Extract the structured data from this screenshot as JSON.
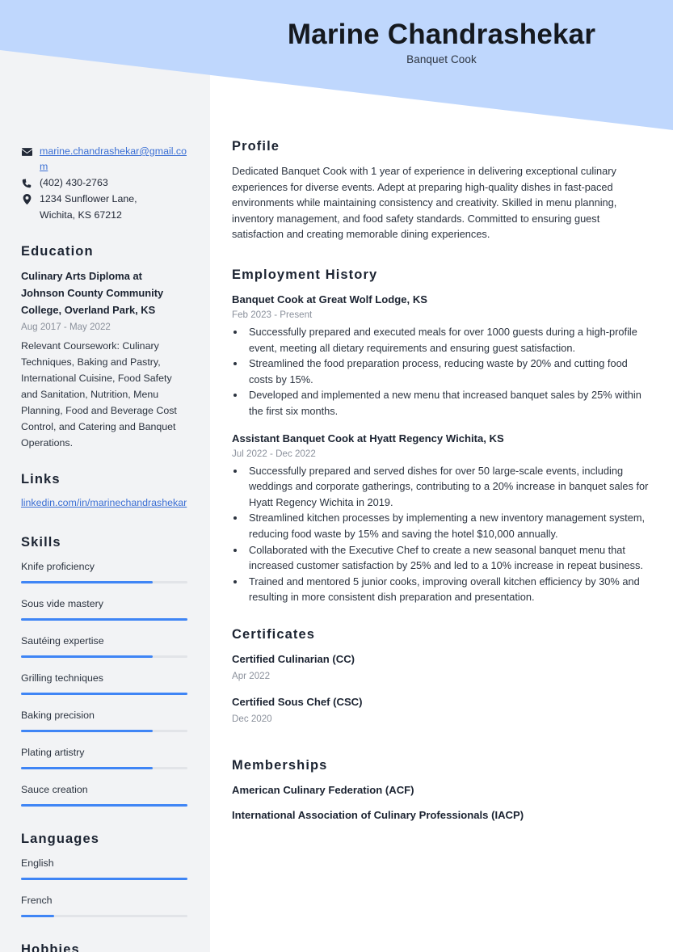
{
  "header": {
    "name": "Marine Chandrashekar",
    "job_title": "Banquet Cook",
    "band_color": "#bfd7fd"
  },
  "theme": {
    "accent": "#3f85f5",
    "link": "#3b6fd4",
    "sidebar_bg": "#f2f3f5",
    "text": "#232a38",
    "muted": "#8b919c"
  },
  "sidebar": {
    "contact": {
      "email": {
        "icon": "envelope-icon",
        "value": "marine.chandrashekar@gmail.com"
      },
      "phone": {
        "icon": "phone-icon",
        "value": "(402) 430-2763"
      },
      "address": {
        "icon": "map-pin-icon",
        "line1": "1234 Sunflower Lane,",
        "line2": "Wichita, KS 67212"
      }
    },
    "education": {
      "heading": "Education",
      "items": [
        {
          "title": "Culinary Arts Diploma at Johnson County Community College, Overland Park, KS",
          "date": "Aug 2017 - May 2022",
          "description": "Relevant Coursework: Culinary Techniques, Baking and Pastry, International Cuisine, Food Safety and Sanitation, Nutrition, Menu Planning, Food and Beverage Cost Control, and Catering and Banquet Operations."
        }
      ]
    },
    "links": {
      "heading": "Links",
      "items": [
        {
          "label": "linkedin.com/in/marinechandrashekar"
        }
      ]
    },
    "skills": {
      "heading": "Skills",
      "items": [
        {
          "label": "Knife proficiency",
          "level": 79
        },
        {
          "label": "Sous vide mastery",
          "level": 100
        },
        {
          "label": "Sautéing expertise",
          "level": 79
        },
        {
          "label": "Grilling techniques",
          "level": 100
        },
        {
          "label": "Baking precision",
          "level": 79
        },
        {
          "label": "Plating artistry",
          "level": 79
        },
        {
          "label": "Sauce creation",
          "level": 100
        }
      ]
    },
    "languages": {
      "heading": "Languages",
      "items": [
        {
          "label": "English",
          "level": 100
        },
        {
          "label": "French",
          "level": 20
        }
      ]
    },
    "hobbies": {
      "heading": "Hobbies"
    }
  },
  "main": {
    "profile": {
      "heading": "Profile",
      "text": "Dedicated Banquet Cook with 1 year of experience in delivering exceptional culinary experiences for diverse events. Adept at preparing high-quality dishes in fast-paced environments while maintaining consistency and creativity. Skilled in menu planning, inventory management, and food safety standards. Committed to ensuring guest satisfaction and creating memorable dining experiences."
    },
    "employment": {
      "heading": "Employment History",
      "jobs": [
        {
          "title": "Banquet Cook at Great Wolf Lodge, KS",
          "date": "Feb 2023 - Present",
          "bullets": [
            "Successfully prepared and executed meals for over 1000 guests during a high-profile event, meeting all dietary requirements and ensuring guest satisfaction.",
            "Streamlined the food preparation process, reducing waste by 20% and cutting food costs by 15%.",
            "Developed and implemented a new menu that increased banquet sales by 25% within the first six months."
          ]
        },
        {
          "title": "Assistant Banquet Cook at Hyatt Regency Wichita, KS",
          "date": "Jul 2022 - Dec 2022",
          "bullets": [
            "Successfully prepared and served dishes for over 50 large-scale events, including weddings and corporate gatherings, contributing to a 20% increase in banquet sales for Hyatt Regency Wichita in 2019.",
            "Streamlined kitchen processes by implementing a new inventory management system, reducing food waste by 15% and saving the hotel $10,000 annually.",
            "Collaborated with the Executive Chef to create a new seasonal banquet menu that increased customer satisfaction by 25% and led to a 10% increase in repeat business.",
            "Trained and mentored 5 junior cooks, improving overall kitchen efficiency by 30% and resulting in more consistent dish preparation and presentation."
          ]
        }
      ]
    },
    "certificates": {
      "heading": "Certificates",
      "items": [
        {
          "title": "Certified Culinarian (CC)",
          "date": "Apr 2022"
        },
        {
          "title": "Certified Sous Chef (CSC)",
          "date": "Dec 2020"
        }
      ]
    },
    "memberships": {
      "heading": "Memberships",
      "items": [
        {
          "title": "American Culinary Federation (ACF)"
        },
        {
          "title": "International Association of Culinary Professionals (IACP)"
        }
      ]
    }
  }
}
